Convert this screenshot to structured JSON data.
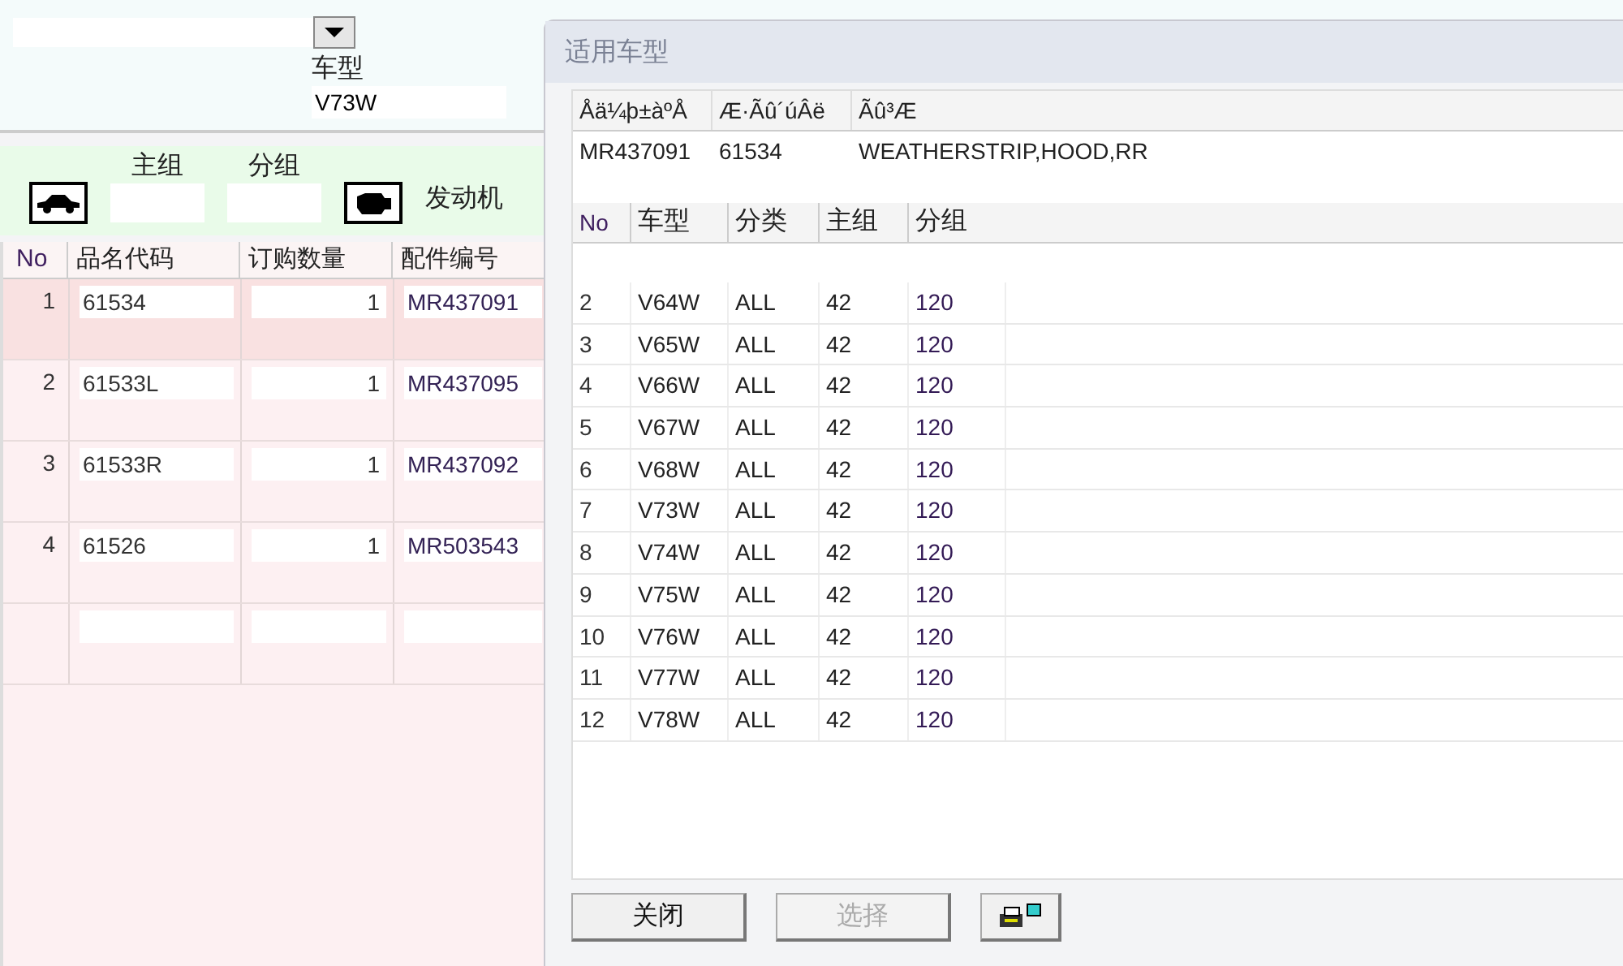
{
  "form": {
    "vehicle_type_label": "车型",
    "vehicle_type_value": "V73W",
    "main_group_label": "主组",
    "sub_group_label": "分组",
    "engine_label": "发动机"
  },
  "parts_table": {
    "columns": [
      "No",
      "品名代码",
      "订购数量",
      "配件编号"
    ],
    "rows": [
      {
        "no": "1",
        "code": "61534",
        "qty": "1",
        "part_no": "MR437091",
        "selected": true
      },
      {
        "no": "2",
        "code": "61533L",
        "qty": "1",
        "part_no": "MR437095",
        "selected": false
      },
      {
        "no": "3",
        "code": "61533R",
        "qty": "1",
        "part_no": "MR437092",
        "selected": false
      },
      {
        "no": "4",
        "code": "61526",
        "qty": "1",
        "part_no": "MR503543",
        "selected": false
      }
    ]
  },
  "dialog": {
    "title": "适用车型",
    "info_columns": [
      "Åä¼þ±àºÅ",
      "Æ·Ãû´úÂë",
      "Ãû³Æ"
    ],
    "info_values": [
      "MR437091",
      "61534",
      "WEATHERSTRIP,HOOD,RR"
    ],
    "columns": [
      "No",
      "车型",
      "分类",
      "主组",
      "分组"
    ],
    "rows": [
      [
        "2",
        "V64W",
        "ALL",
        "42",
        "120"
      ],
      [
        "3",
        "V65W",
        "ALL",
        "42",
        "120"
      ],
      [
        "4",
        "V66W",
        "ALL",
        "42",
        "120"
      ],
      [
        "5",
        "V67W",
        "ALL",
        "42",
        "120"
      ],
      [
        "6",
        "V68W",
        "ALL",
        "42",
        "120"
      ],
      [
        "7",
        "V73W",
        "ALL",
        "42",
        "120"
      ],
      [
        "8",
        "V74W",
        "ALL",
        "42",
        "120"
      ],
      [
        "9",
        "V75W",
        "ALL",
        "42",
        "120"
      ],
      [
        "10",
        "V76W",
        "ALL",
        "42",
        "120"
      ],
      [
        "11",
        "V77W",
        "ALL",
        "42",
        "120"
      ],
      [
        "12",
        "V78W",
        "ALL",
        "42",
        "120"
      ]
    ],
    "buttons": [
      {
        "label": "关闭",
        "disabled": false
      },
      {
        "label": "选择",
        "disabled": true
      }
    ]
  }
}
